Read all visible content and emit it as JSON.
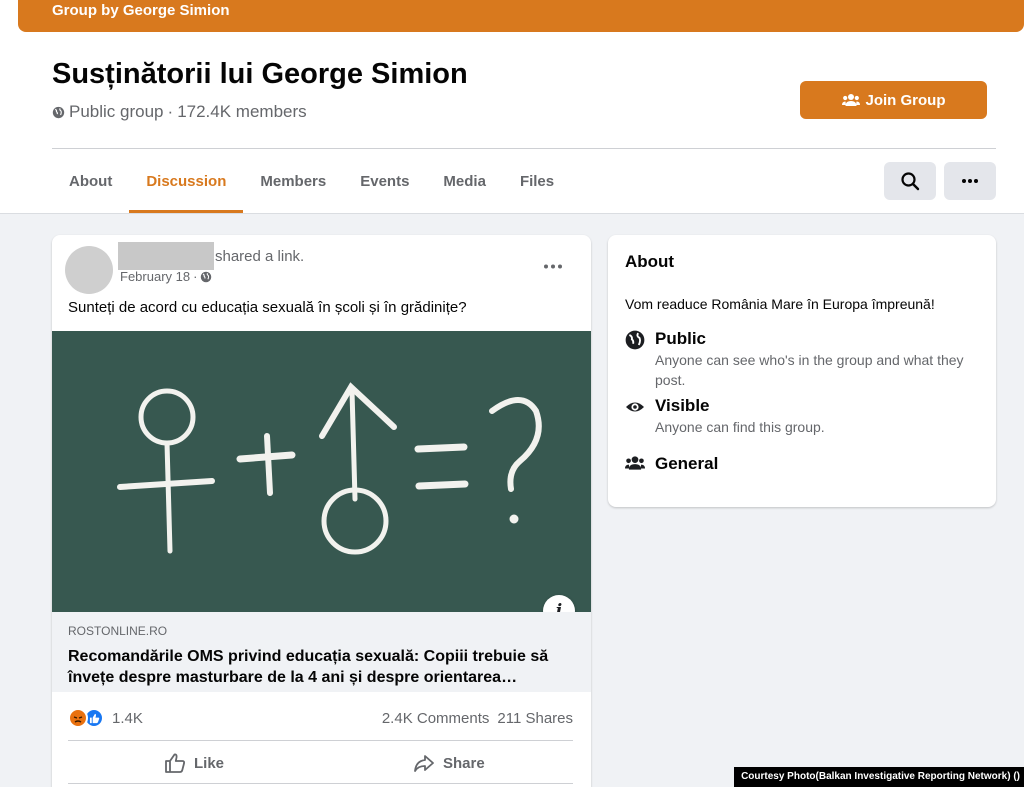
{
  "banner": {
    "text": "Group by George Simion"
  },
  "group": {
    "title": "Susținătorii lui George Simion",
    "privacy": "Public group",
    "separator": "·",
    "members": "172.4K members"
  },
  "join_button": {
    "label": "Join Group",
    "icon": "people-icon"
  },
  "tabs": [
    {
      "label": "About"
    },
    {
      "label": "Discussion",
      "active": true
    },
    {
      "label": "Members"
    },
    {
      "label": "Events"
    },
    {
      "label": "Media"
    },
    {
      "label": "Files"
    }
  ],
  "toolbar": {
    "search_icon": "search-icon",
    "more_icon": "more-horizontal-icon"
  },
  "post": {
    "action_text": "shared a link.",
    "date": "February 18",
    "date_separator": "·",
    "text": "Sunteți de acord cu educația sexuală în școli și în grădinițe?",
    "link": {
      "domain": "ROSTONLINE.RO",
      "title": "Recomandările OMS privind educația sexuală: Copiii trebuie să învețe despre masturbare de la 4 ani și despre orientarea…",
      "info_glyph": "i"
    },
    "reactions": {
      "count": "1.4K",
      "comments": "2.4K Comments",
      "shares": "211 Shares"
    },
    "actions": {
      "like": "Like",
      "share": "Share"
    }
  },
  "about": {
    "heading": "About",
    "description": "Vom readuce România Mare în Europa împreună!",
    "items": [
      {
        "icon": "globe-icon",
        "title": "Public",
        "subtitle": "Anyone can see who's in the group and what they post."
      },
      {
        "icon": "eye-icon",
        "title": "Visible",
        "subtitle": "Anyone can find this group."
      },
      {
        "icon": "people-icon",
        "title": "General",
        "subtitle": ""
      }
    ]
  },
  "credit": "Courtesy Photo(Balkan Investigative Reporting Network) ()",
  "colors": {
    "accent": "#d8791e",
    "background": "#f0f2f5",
    "chalkboard": "#3c5f56"
  }
}
